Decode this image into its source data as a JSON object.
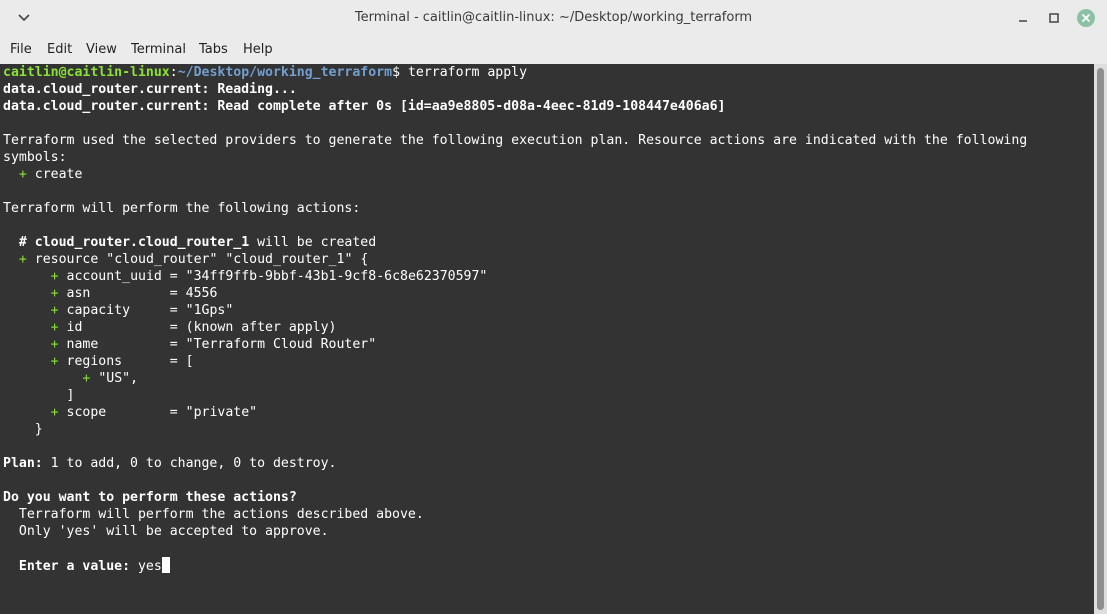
{
  "window": {
    "title": "Terminal - caitlin@caitlin-linux: ~/Desktop/working_terraform"
  },
  "menu": [
    "File",
    "Edit",
    "View",
    "Terminal",
    "Tabs",
    "Help"
  ],
  "prompt": {
    "user_host": "caitlin@caitlin-linux",
    "sep": ":",
    "path": "~/Desktop/working_terraform",
    "dollar": "$",
    "command": " terraform apply"
  },
  "lines": {
    "l2": "data.cloud_router.current: Reading...",
    "l3": "data.cloud_router.current: Read complete after 0s [id=aa9e8805-d08a-4eec-81d9-108447e406a6]",
    "l5": "Terraform used the selected providers to generate the following execution plan. Resource actions are indicated with the following",
    "l6": "symbols:",
    "l7": "create",
    "l9": "Terraform will perform the following actions:",
    "l11a": "# cloud_router.cloud_router_1",
    "l11b": " will be created",
    "l12": "resource \"cloud_router\" \"cloud_router_1\" {",
    "l13": "account_uuid = \"34ff9ffb-9bbf-43b1-9cf8-6c8e62370597\"",
    "l14": "asn          = 4556",
    "l15": "capacity     = \"1Gps\"",
    "l16": "id           = (known after apply)",
    "l17": "name         = \"Terraform Cloud Router\"",
    "l18": "regions      = [",
    "l19": "\"US\",",
    "l20": "]",
    "l21": "scope        = \"private\"",
    "l22": "}",
    "l24a": "Plan:",
    "l24b": " 1 to add, 0 to change, 0 to destroy.",
    "l26": "Do you want to perform these actions?",
    "l27": "Terraform will perform the actions described above.",
    "l28": "Only 'yes' will be accepted to approve.",
    "l30a": "Enter a value:",
    "l30b": " yes"
  },
  "plus": "+"
}
